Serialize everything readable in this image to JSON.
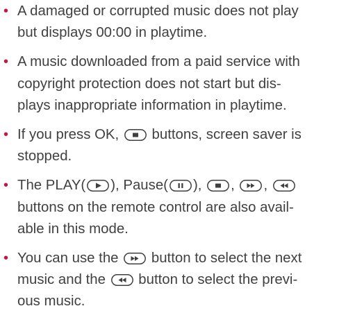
{
  "bullet_glyph": "•",
  "accent_color": "#c6163f",
  "text_color": "#404040",
  "notes": [
    {
      "l1": "A damaged or corrupted music does not play",
      "l2": "but displays 00:00 in playtime."
    },
    {
      "l1": "A music downloaded from a paid service with",
      "l2": "copyright protection does not start but dis-",
      "l3": "plays inappropriate information in playtime."
    },
    {
      "l1a": "If you press OK,",
      "l1b": "buttons, screen saver is",
      "l2": "stopped."
    },
    {
      "l1a": "The PLAY(",
      "l1b": "), Pause(",
      "l1c": "),",
      "l1d": ",",
      "l1e": ",",
      "l2": "buttons on the remote control are also avail-",
      "l3": "able in this mode."
    },
    {
      "l1a": "You can use the",
      "l1b": "button to select the next",
      "l2a": "music and the",
      "l2b": "button to select the previ-",
      "l3": "ous music."
    }
  ],
  "icons": {
    "stop": "stop-button-icon",
    "play": "play-button-icon",
    "pause": "pause-button-icon",
    "forward": "fast-forward-button-icon",
    "rewind": "rewind-button-icon"
  }
}
